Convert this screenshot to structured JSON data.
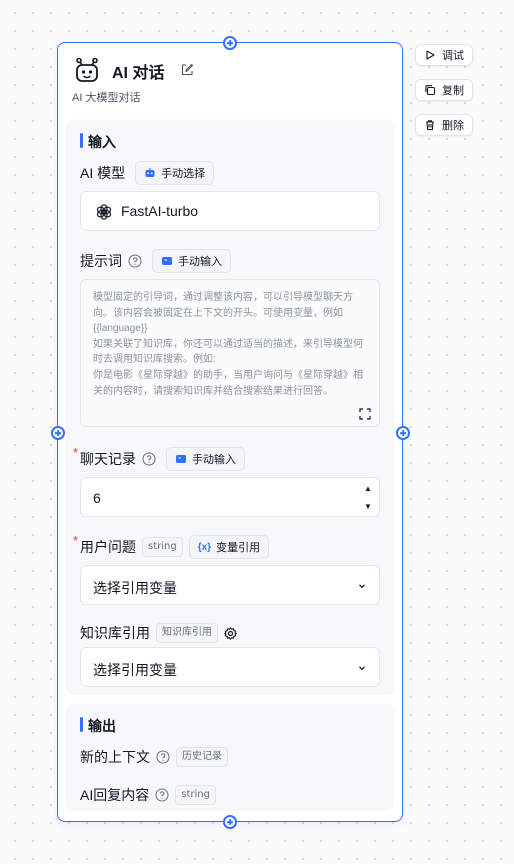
{
  "node": {
    "title": "AI 对话",
    "description": "AI 大模型对话"
  },
  "side_actions": [
    {
      "label": "调试",
      "icon": "play-icon"
    },
    {
      "label": "复制",
      "icon": "copy-icon"
    },
    {
      "label": "删除",
      "icon": "trash-icon"
    }
  ],
  "inputs": {
    "title": "输入",
    "model": {
      "label": "AI 模型",
      "mode_label": "手动选择",
      "value": "FastAI-turbo"
    },
    "prompt": {
      "label": "提示词",
      "mode_label": "手动输入",
      "placeholder": "模型固定的引导词，通过调整该内容，可以引导模型聊天方向。该内容会被固定在上下文的开头。可使用变量，例如 {{language}}\n如果关联了知识库，你还可以通过适当的描述，来引导模型何时去调用知识库搜索。例如:\n你是电影《星际穿越》的助手，当用户询问与《星际穿越》相关的内容时，请搜索知识库并结合搜索结果进行回答。"
    },
    "history": {
      "label": "聊天记录",
      "mode_label": "手动输入",
      "value": "6",
      "required": "*"
    },
    "user_question": {
      "label": "用户问题",
      "type_tag": "string",
      "mode_label": "变量引用",
      "select_value": "选择引用变量",
      "required": "*"
    },
    "knowledge": {
      "label": "知识库引用",
      "type_tag": "知识库引用",
      "select_value": "选择引用变量"
    }
  },
  "outputs": {
    "title": "输出",
    "items": [
      {
        "label": "新的上下文",
        "tag": "历史记录"
      },
      {
        "label": "AI回复内容",
        "tag": "string"
      }
    ]
  },
  "colors": {
    "accent": "#3370ff",
    "required": "#e82f2f"
  }
}
